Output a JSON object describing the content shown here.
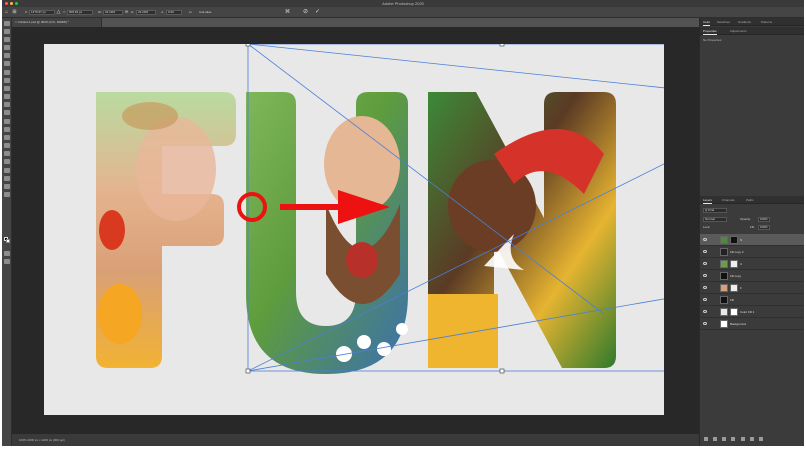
{
  "window": {
    "title": "Adobe Photoshop 2020"
  },
  "options_bar": {
    "x_value": "1476.67 px",
    "y_value": "609.63 px",
    "width_value": "22.29%",
    "height_value": "22.29%",
    "angle_value": "0.00",
    "anti_alias_label": "Anti-alias",
    "cancel_label": "⊘",
    "commit_label": "✓"
  },
  "document": {
    "tab_label": "Untitled-1.psd @ 300% (F/U, RGB/8) *",
    "status_text": "100%     2000 px x 1200 px (300 ppi)"
  },
  "canvas": {
    "letters": [
      "F",
      "U",
      "N"
    ],
    "background_color": "#e8e8e8",
    "arrow_color": "#ee1111"
  },
  "panels": {
    "top_tabs": [
      "Color",
      "Swatches",
      "Gradients",
      "Patterns"
    ],
    "props_tabs": [
      "Properties",
      "Adjustments"
    ],
    "props_text": "No Properties",
    "layers_tabs": [
      "Layers",
      "Channels",
      "Paths"
    ],
    "kind_label": "Q Kind",
    "blend_mode": "Normal",
    "opacity_label": "Opacity:",
    "opacity_value": "100%",
    "lock_label": "Lock:",
    "fill_label": "Fill:",
    "fill_value": "100%"
  },
  "layers": [
    {
      "name": "N",
      "selected": true
    },
    {
      "name": "Fill copy 2",
      "selected": false
    },
    {
      "name": "U",
      "selected": false
    },
    {
      "name": "Fill copy",
      "selected": false
    },
    {
      "name": "F",
      "selected": false
    },
    {
      "name": "Fill",
      "selected": false
    },
    {
      "name": "Color Fill 1",
      "selected": false
    },
    {
      "name": "Background",
      "selected": false
    }
  ]
}
